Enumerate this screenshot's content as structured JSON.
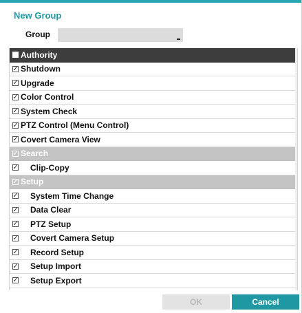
{
  "dialog": {
    "title": "New Group",
    "group_label": "Group",
    "group_value": ""
  },
  "list": {
    "rows": [
      {
        "label": "Authority",
        "type": "header",
        "checked": false
      },
      {
        "label": "Shutdown",
        "type": "item",
        "checked": true
      },
      {
        "label": "Upgrade",
        "type": "item",
        "checked": true
      },
      {
        "label": "Color Control",
        "type": "item",
        "checked": true
      },
      {
        "label": "System Check",
        "type": "item",
        "checked": true
      },
      {
        "label": "PTZ Control (Menu Control)",
        "type": "item",
        "checked": true
      },
      {
        "label": "Covert Camera View",
        "type": "item",
        "checked": true
      },
      {
        "label": "Search",
        "type": "section",
        "checked": true
      },
      {
        "label": "Clip-Copy",
        "type": "subitem",
        "checked": true
      },
      {
        "label": "Setup",
        "type": "section",
        "checked": true
      },
      {
        "label": "System Time Change",
        "type": "subitem",
        "checked": true
      },
      {
        "label": "Data Clear",
        "type": "subitem",
        "checked": true
      },
      {
        "label": "PTZ Setup",
        "type": "subitem",
        "checked": true
      },
      {
        "label": "Covert Camera Setup",
        "type": "subitem",
        "checked": true
      },
      {
        "label": "Record Setup",
        "type": "subitem",
        "checked": true
      },
      {
        "label": "Setup Import",
        "type": "subitem",
        "checked": true
      },
      {
        "label": "Setup Export",
        "type": "subitem",
        "checked": true
      }
    ]
  },
  "buttons": {
    "ok": "OK",
    "cancel": "Cancel"
  },
  "colors": {
    "accent": "#1f98a3",
    "header_bg": "#3d3d3d",
    "section_bg": "#c4c4c4"
  }
}
